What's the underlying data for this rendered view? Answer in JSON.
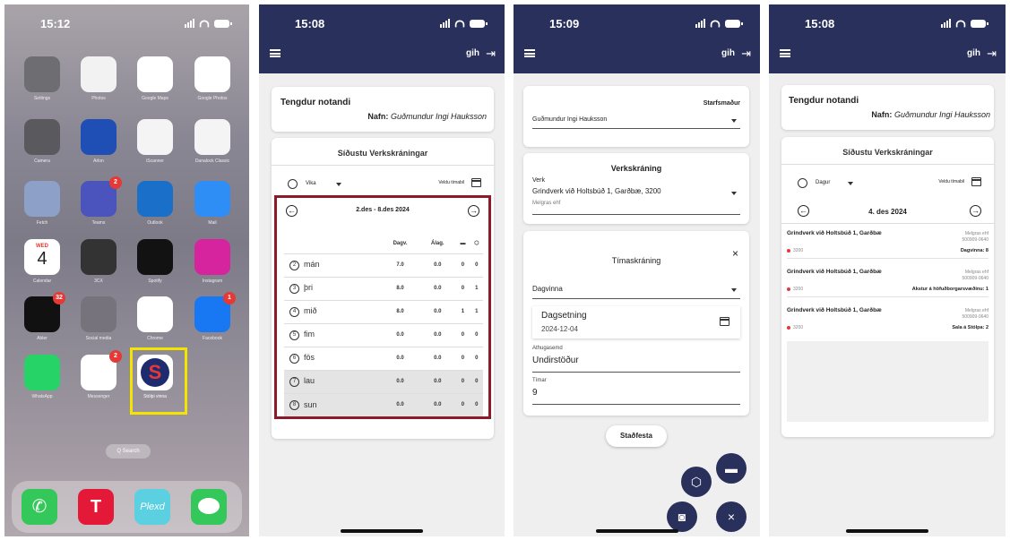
{
  "phone1": {
    "time": "15:12",
    "apps": [
      {
        "label": "Settings",
        "color": "#6d6d72"
      },
      {
        "label": "Photos",
        "color": "#f2f2f2"
      },
      {
        "label": "Google Maps",
        "color": "#ffffff"
      },
      {
        "label": "Google Photos",
        "color": "#ffffff"
      },
      {
        "label": "Camera",
        "color": "#5a5a5e"
      },
      {
        "label": "Arlon",
        "color": "#1f4fb5"
      },
      {
        "label": "iScanner",
        "color": "#f4f4f4"
      },
      {
        "label": "Danalock Classic",
        "color": "#f4f4f4"
      },
      {
        "label": "Fetch",
        "color": "#8ca0c8"
      },
      {
        "label": "Teams",
        "color": "#4b53bc",
        "badge": "2"
      },
      {
        "label": "Outlook",
        "color": "#1a6fc9"
      },
      {
        "label": "Mail",
        "color": "#2f8ef5"
      },
      {
        "label": "Calendar",
        "color": "#ffffff",
        "day": "WED",
        "date": "4"
      },
      {
        "label": "3CX",
        "color": "#333333"
      },
      {
        "label": "Spotify",
        "color": "#121212"
      },
      {
        "label": "Instagram",
        "color": "#d6249f"
      },
      {
        "label": "Abler",
        "color": "#111111",
        "badge": "32"
      },
      {
        "label": "Social media",
        "color": "#77737d"
      },
      {
        "label": "Chrome",
        "color": "#ffffff"
      },
      {
        "label": "Facebook",
        "color": "#1877f2",
        "badge": "1"
      },
      {
        "label": "WhatsApp",
        "color": "#25d366"
      },
      {
        "label": "Messenger",
        "color": "#ffffff",
        "badge": "2"
      },
      {
        "label": "Stólpi vinna",
        "color": "#ffffff"
      }
    ],
    "search": "Q Search",
    "dock": [
      "Phone",
      "Tesla",
      "Plexd",
      "Messages"
    ]
  },
  "phone2": {
    "time": "15:08",
    "user": "gih",
    "connected_title": "Tengdur notandi",
    "name_label": "Nafn:",
    "name_value": "Guðmundur Ingi Hauksson",
    "recent_title": "Síðustu Verkskráningar",
    "period": "Vika",
    "pick_period": "Veldu tímabil",
    "range": "2.des - 8.des 2024",
    "cols": [
      "Dagv.",
      "Álag."
    ],
    "rows": [
      {
        "n": "2",
        "day": "mán",
        "v": [
          "7.0",
          "0.0",
          "0",
          "0"
        ]
      },
      {
        "n": "3",
        "day": "þri",
        "v": [
          "8.0",
          "0.0",
          "0",
          "1"
        ]
      },
      {
        "n": "4",
        "day": "mið",
        "v": [
          "8.0",
          "0.0",
          "1",
          "1"
        ]
      },
      {
        "n": "5",
        "day": "fim",
        "v": [
          "0.0",
          "0.0",
          "0",
          "0"
        ]
      },
      {
        "n": "6",
        "day": "fös",
        "v": [
          "0.0",
          "0.0",
          "0",
          "0"
        ]
      },
      {
        "n": "7",
        "day": "lau",
        "v": [
          "0.0",
          "0.0",
          "0",
          "0"
        ]
      },
      {
        "n": "8",
        "day": "sun",
        "v": [
          "0.0",
          "0.0",
          "0",
          "0"
        ]
      }
    ]
  },
  "phone3": {
    "time": "15:09",
    "user": "gih",
    "employee_label": "Starfsmaður",
    "employee_value": "Guðmundur Ingi Hauksson",
    "work_title": "Verkskráning",
    "verk_label": "Verk",
    "verk_value": "Grindverk við Holtsbúð 1, Garðbæ, 3200",
    "verk_sub": "Melgras ehf",
    "time_title": "Tímaskráning",
    "type_value": "Dagvinna",
    "date_label": "Dagsetning",
    "date_value": "2024-12-04",
    "note_label": "Athugasemd",
    "note_value": "Undirstöður",
    "hours_label": "Tímar",
    "hours_value": "9",
    "confirm": "Staðfesta"
  },
  "phone4": {
    "time": "15:08",
    "user": "gih",
    "connected_title": "Tengdur notandi",
    "name_label": "Nafn:",
    "name_value": "Guðmundur Ingi Hauksson",
    "recent_title": "Síðustu Verkskráningar",
    "period": "Dagur",
    "pick_period": "Veldu tímabil",
    "date": "4. des 2024",
    "entries": [
      {
        "title": "Grindverk við Holtsbúð 1, Garðbæ",
        "company": "Melgras ehf",
        "kt": "500909-0640",
        "code": "3200",
        "desc": "Dagvinna: 8"
      },
      {
        "title": "Grindverk við Holtsbúð 1, Garðbæ",
        "company": "Melgras ehf",
        "kt": "500909-0640",
        "code": "3200",
        "desc": "Akstur á höfuðborgarsvæðinu: 1"
      },
      {
        "title": "Grindverk við Holtsbúð 1, Garðbæ",
        "company": "Melgras ehf",
        "kt": "500909-0640",
        "code": "3200",
        "desc": "Sala á Stólpa: 2"
      }
    ]
  },
  "colors": {
    "navy": "#29305b",
    "highlight_red": "#8b1a2b",
    "highlight_yellow": "#f4e400"
  }
}
